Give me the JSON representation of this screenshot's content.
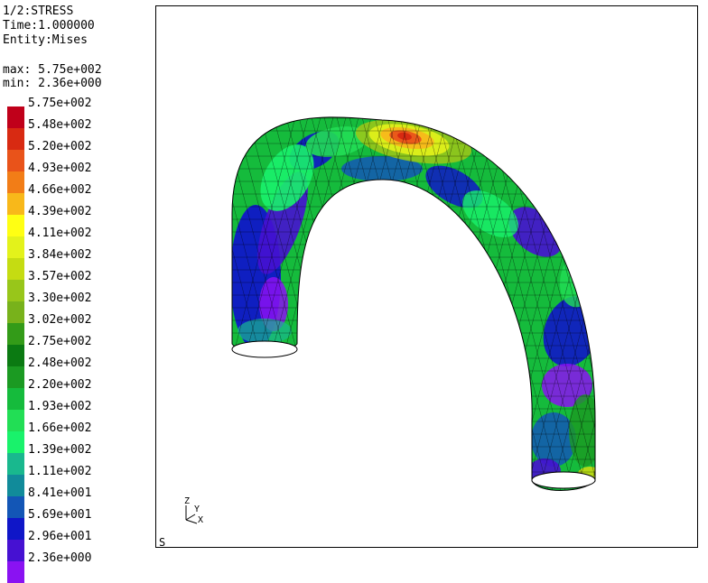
{
  "header": {
    "line1": "1/2:STRESS",
    "line2": "Time:1.000000",
    "line3": "Entity:Mises",
    "max_line": "max: 5.75e+002",
    "min_line": "min: 2.36e+000"
  },
  "legend": [
    {
      "label": "5.75e+002",
      "color": "#c0001a"
    },
    {
      "label": "5.48e+002",
      "color": "#d82a12"
    },
    {
      "label": "5.20e+002",
      "color": "#e9531a"
    },
    {
      "label": "4.93e+002",
      "color": "#f27d17"
    },
    {
      "label": "4.66e+002",
      "color": "#f8b81a"
    },
    {
      "label": "4.39e+002",
      "color": "#ffff13"
    },
    {
      "label": "4.11e+002",
      "color": "#e3f21b"
    },
    {
      "label": "3.84e+002",
      "color": "#c5dc12"
    },
    {
      "label": "3.57e+002",
      "color": "#98c61a"
    },
    {
      "label": "3.30e+002",
      "color": "#78b21b"
    },
    {
      "label": "3.02e+002",
      "color": "#339b18"
    },
    {
      "label": "2.75e+002",
      "color": "#0b7a12"
    },
    {
      "label": "2.48e+002",
      "color": "#1b9a22"
    },
    {
      "label": "2.20e+002",
      "color": "#15bb3c"
    },
    {
      "label": "1.93e+002",
      "color": "#22de55"
    },
    {
      "label": "1.66e+002",
      "color": "#19f26b"
    },
    {
      "label": "1.39e+002",
      "color": "#19b88e"
    },
    {
      "label": "1.11e+002",
      "color": "#118b9a"
    },
    {
      "label": "8.41e+001",
      "color": "#1356b6"
    },
    {
      "label": "5.69e+001",
      "color": "#0f16c8"
    },
    {
      "label": "2.96e+001",
      "color": "#4611d2"
    },
    {
      "label": "2.36e+000",
      "color": "#8a12f2"
    }
  ],
  "triad": {
    "z": "Z",
    "y": "Y",
    "x": "X"
  },
  "status": {
    "s": "S"
  }
}
